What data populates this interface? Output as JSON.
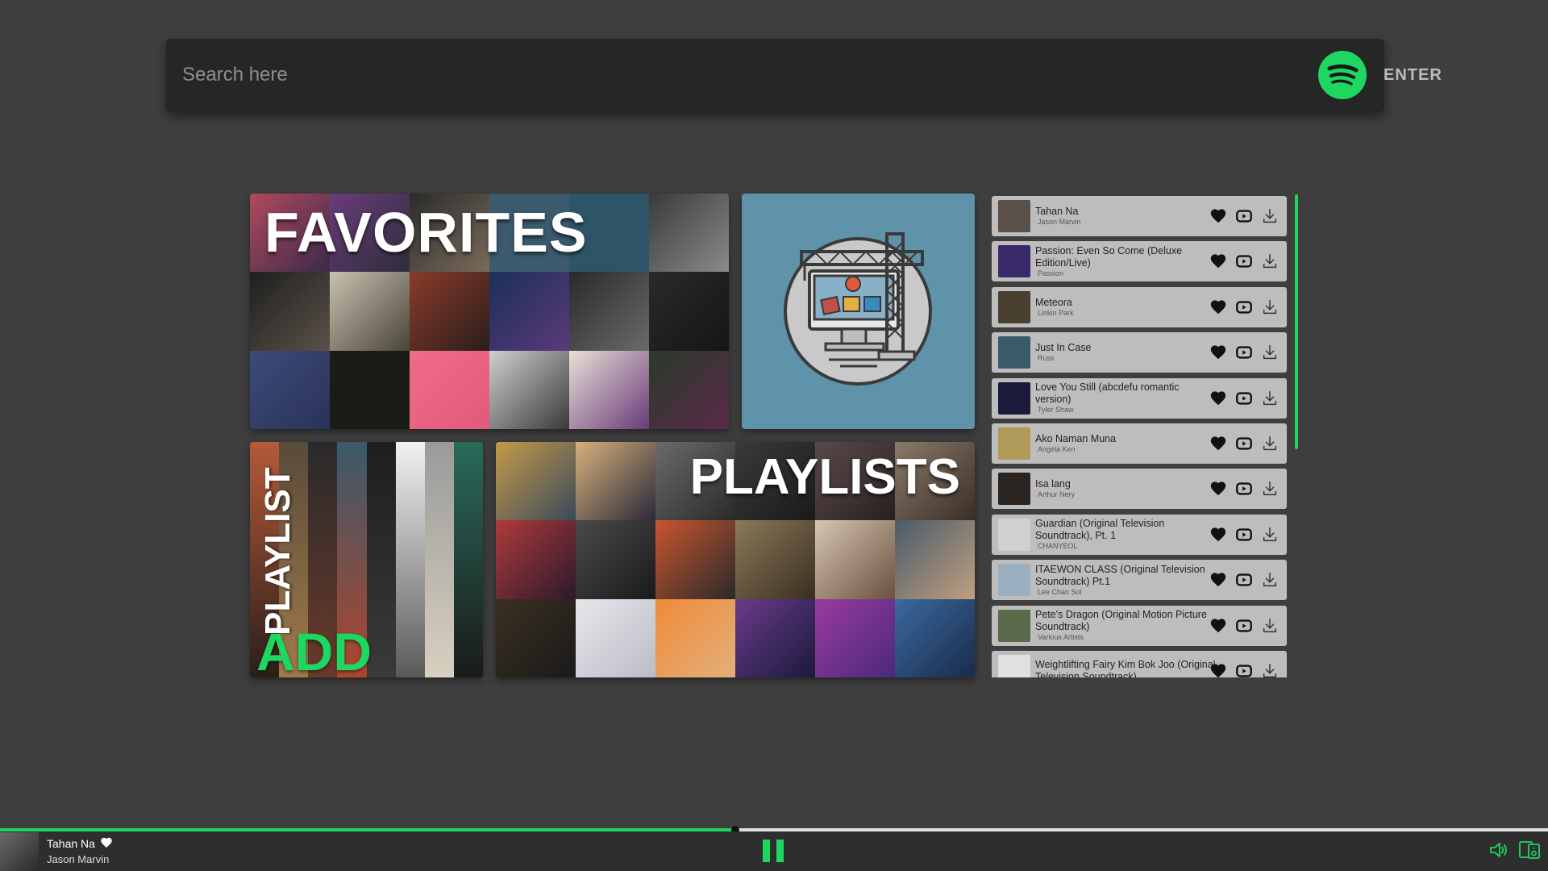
{
  "search": {
    "placeholder": "Search here",
    "enter_label": "ENTER"
  },
  "tiles": {
    "favorites_label": "FAVORITES",
    "add_playlist_side_label": "PLAYLIST",
    "add_playlist_label": "ADD",
    "playlists_label": "PLAYLISTS"
  },
  "tracks": [
    {
      "title": "Tahan Na",
      "artist": "Jason Marvin",
      "thumb_color": "#5a5048"
    },
    {
      "title": "Passion: Even So Come (Deluxe Edition/Live)",
      "artist": "Passion",
      "thumb_color": "#3a2a6a"
    },
    {
      "title": "Meteora",
      "artist": "Linkin Park",
      "thumb_color": "#4a4030"
    },
    {
      "title": "Just In Case",
      "artist": "Russ",
      "thumb_color": "#3a5a6a"
    },
    {
      "title": "Love You Still (abcdefu romantic version)",
      "artist": "Tyler Shaw",
      "thumb_color": "#1a1a3a"
    },
    {
      "title": "Ako Naman Muna",
      "artist": "Angela Ken",
      "thumb_color": "#b09a5a"
    },
    {
      "title": "Isa lang",
      "artist": "Arthur Nery",
      "thumb_color": "#2a2420"
    },
    {
      "title": "Guardian (Original Television Soundtrack), Pt. 1",
      "artist": "CHANYEOL",
      "thumb_color": "#d0d0d0"
    },
    {
      "title": "ITAEWON CLASS (Original Television Soundtrack) Pt.1",
      "artist": "Lee Chan Sol",
      "thumb_color": "#9ab0c0"
    },
    {
      "title": "Pete's Dragon (Original Motion Picture Soundtrack)",
      "artist": "Various Artists",
      "thumb_color": "#5a6a4a"
    },
    {
      "title": "Weightlifting Fairy Kim Bok Joo (Original Television Soundtrack)",
      "artist": "",
      "thumb_color": "#e0e0e0"
    }
  ],
  "player": {
    "title": "Tahan Na",
    "artist": "Jason Marvin",
    "progress_fraction": 0.475
  },
  "colors": {
    "accent": "#1ed760",
    "background": "#3e3e3e",
    "search_bar": "#262626",
    "track_item": "#bdbdbd",
    "construction_tile": "#5f93aa"
  }
}
